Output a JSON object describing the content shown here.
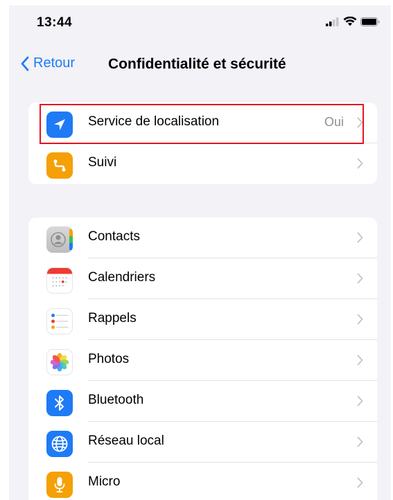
{
  "status_bar": {
    "time": "13:44",
    "icons": [
      "cellular-signal-icon",
      "wifi-icon",
      "battery-icon"
    ]
  },
  "nav": {
    "back_label": "Retour",
    "title": "Confidentialité et sécurité"
  },
  "group1": {
    "items": [
      {
        "label": "Service de localisation",
        "value": "Oui",
        "icon": "location-arrow-icon",
        "icon_color": "#1e7bf5",
        "highlighted": true
      },
      {
        "label": "Suivi",
        "value": "",
        "icon": "tracking-icon",
        "icon_color": "#f5a006",
        "highlighted": false
      }
    ]
  },
  "group2": {
    "items": [
      {
        "label": "Contacts",
        "icon": "contacts-icon",
        "icon_color": "#c9c9c9"
      },
      {
        "label": "Calendriers",
        "icon": "calendar-icon",
        "icon_color": "#ffffff"
      },
      {
        "label": "Rappels",
        "icon": "reminders-icon",
        "icon_color": "#ffffff"
      },
      {
        "label": "Photos",
        "icon": "photos-icon",
        "icon_color": "#ffffff"
      },
      {
        "label": "Bluetooth",
        "icon": "bluetooth-icon",
        "icon_color": "#1e7bf5"
      },
      {
        "label": "Réseau local",
        "icon": "globe-icon",
        "icon_color": "#1e7bf5"
      },
      {
        "label": "Micro",
        "icon": "microphone-icon",
        "icon_color": "#f5a006"
      }
    ]
  },
  "colors": {
    "accent": "#1e7bf5",
    "highlight_border": "#e3151d",
    "background": "#f2f2f7",
    "secondary_text": "#8e8e93"
  }
}
